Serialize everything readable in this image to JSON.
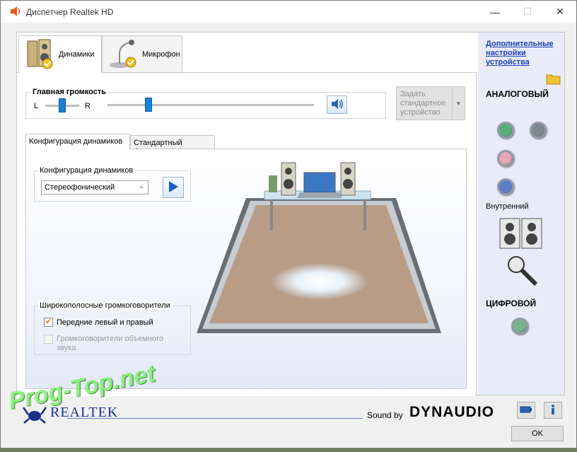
{
  "window": {
    "title": "Диспетчер Realtek HD",
    "minimize": "—",
    "maximize": "☐",
    "close": "✕"
  },
  "device_tabs": [
    {
      "label": "Динамики"
    },
    {
      "label": "Микрофон"
    }
  ],
  "volume": {
    "title": "Главная громкость",
    "left_label": "L",
    "right_label": "R",
    "balance_level": 0.5,
    "master_level": 0.2
  },
  "default_device": {
    "label": "Задать стандартное устройство"
  },
  "sub_tabs": [
    {
      "label": "Конфигурация динамиков"
    },
    {
      "label": "Стандартный формат"
    }
  ],
  "speaker_config": {
    "group_title": "Конфигурация динамиков",
    "selected": "Стереофонический"
  },
  "fullrange": {
    "group_title": "Широкополосные громкоговорители",
    "front": {
      "label": "Передние левый и правый",
      "checked": true
    },
    "surround": {
      "label": "Громкоговорители объемного звука",
      "checked": false
    }
  },
  "side": {
    "advanced_link": "Дополнительные настройки устройства",
    "analog_label": "АНАЛОГОВЫЙ",
    "inner_label": "Внутренний",
    "digital_label": "ЦИФРОВОЙ",
    "jack_colors": [
      "#55b07a",
      "#7d8790",
      "#e6a5b8",
      "#5d7cc9",
      "#79b38a"
    ]
  },
  "footer": {
    "brand": "REALTEK",
    "sound_by": "Sound by",
    "dynaudio": "DYNAUDIO",
    "ok": "OK"
  },
  "watermark": "Prog-Top.net"
}
